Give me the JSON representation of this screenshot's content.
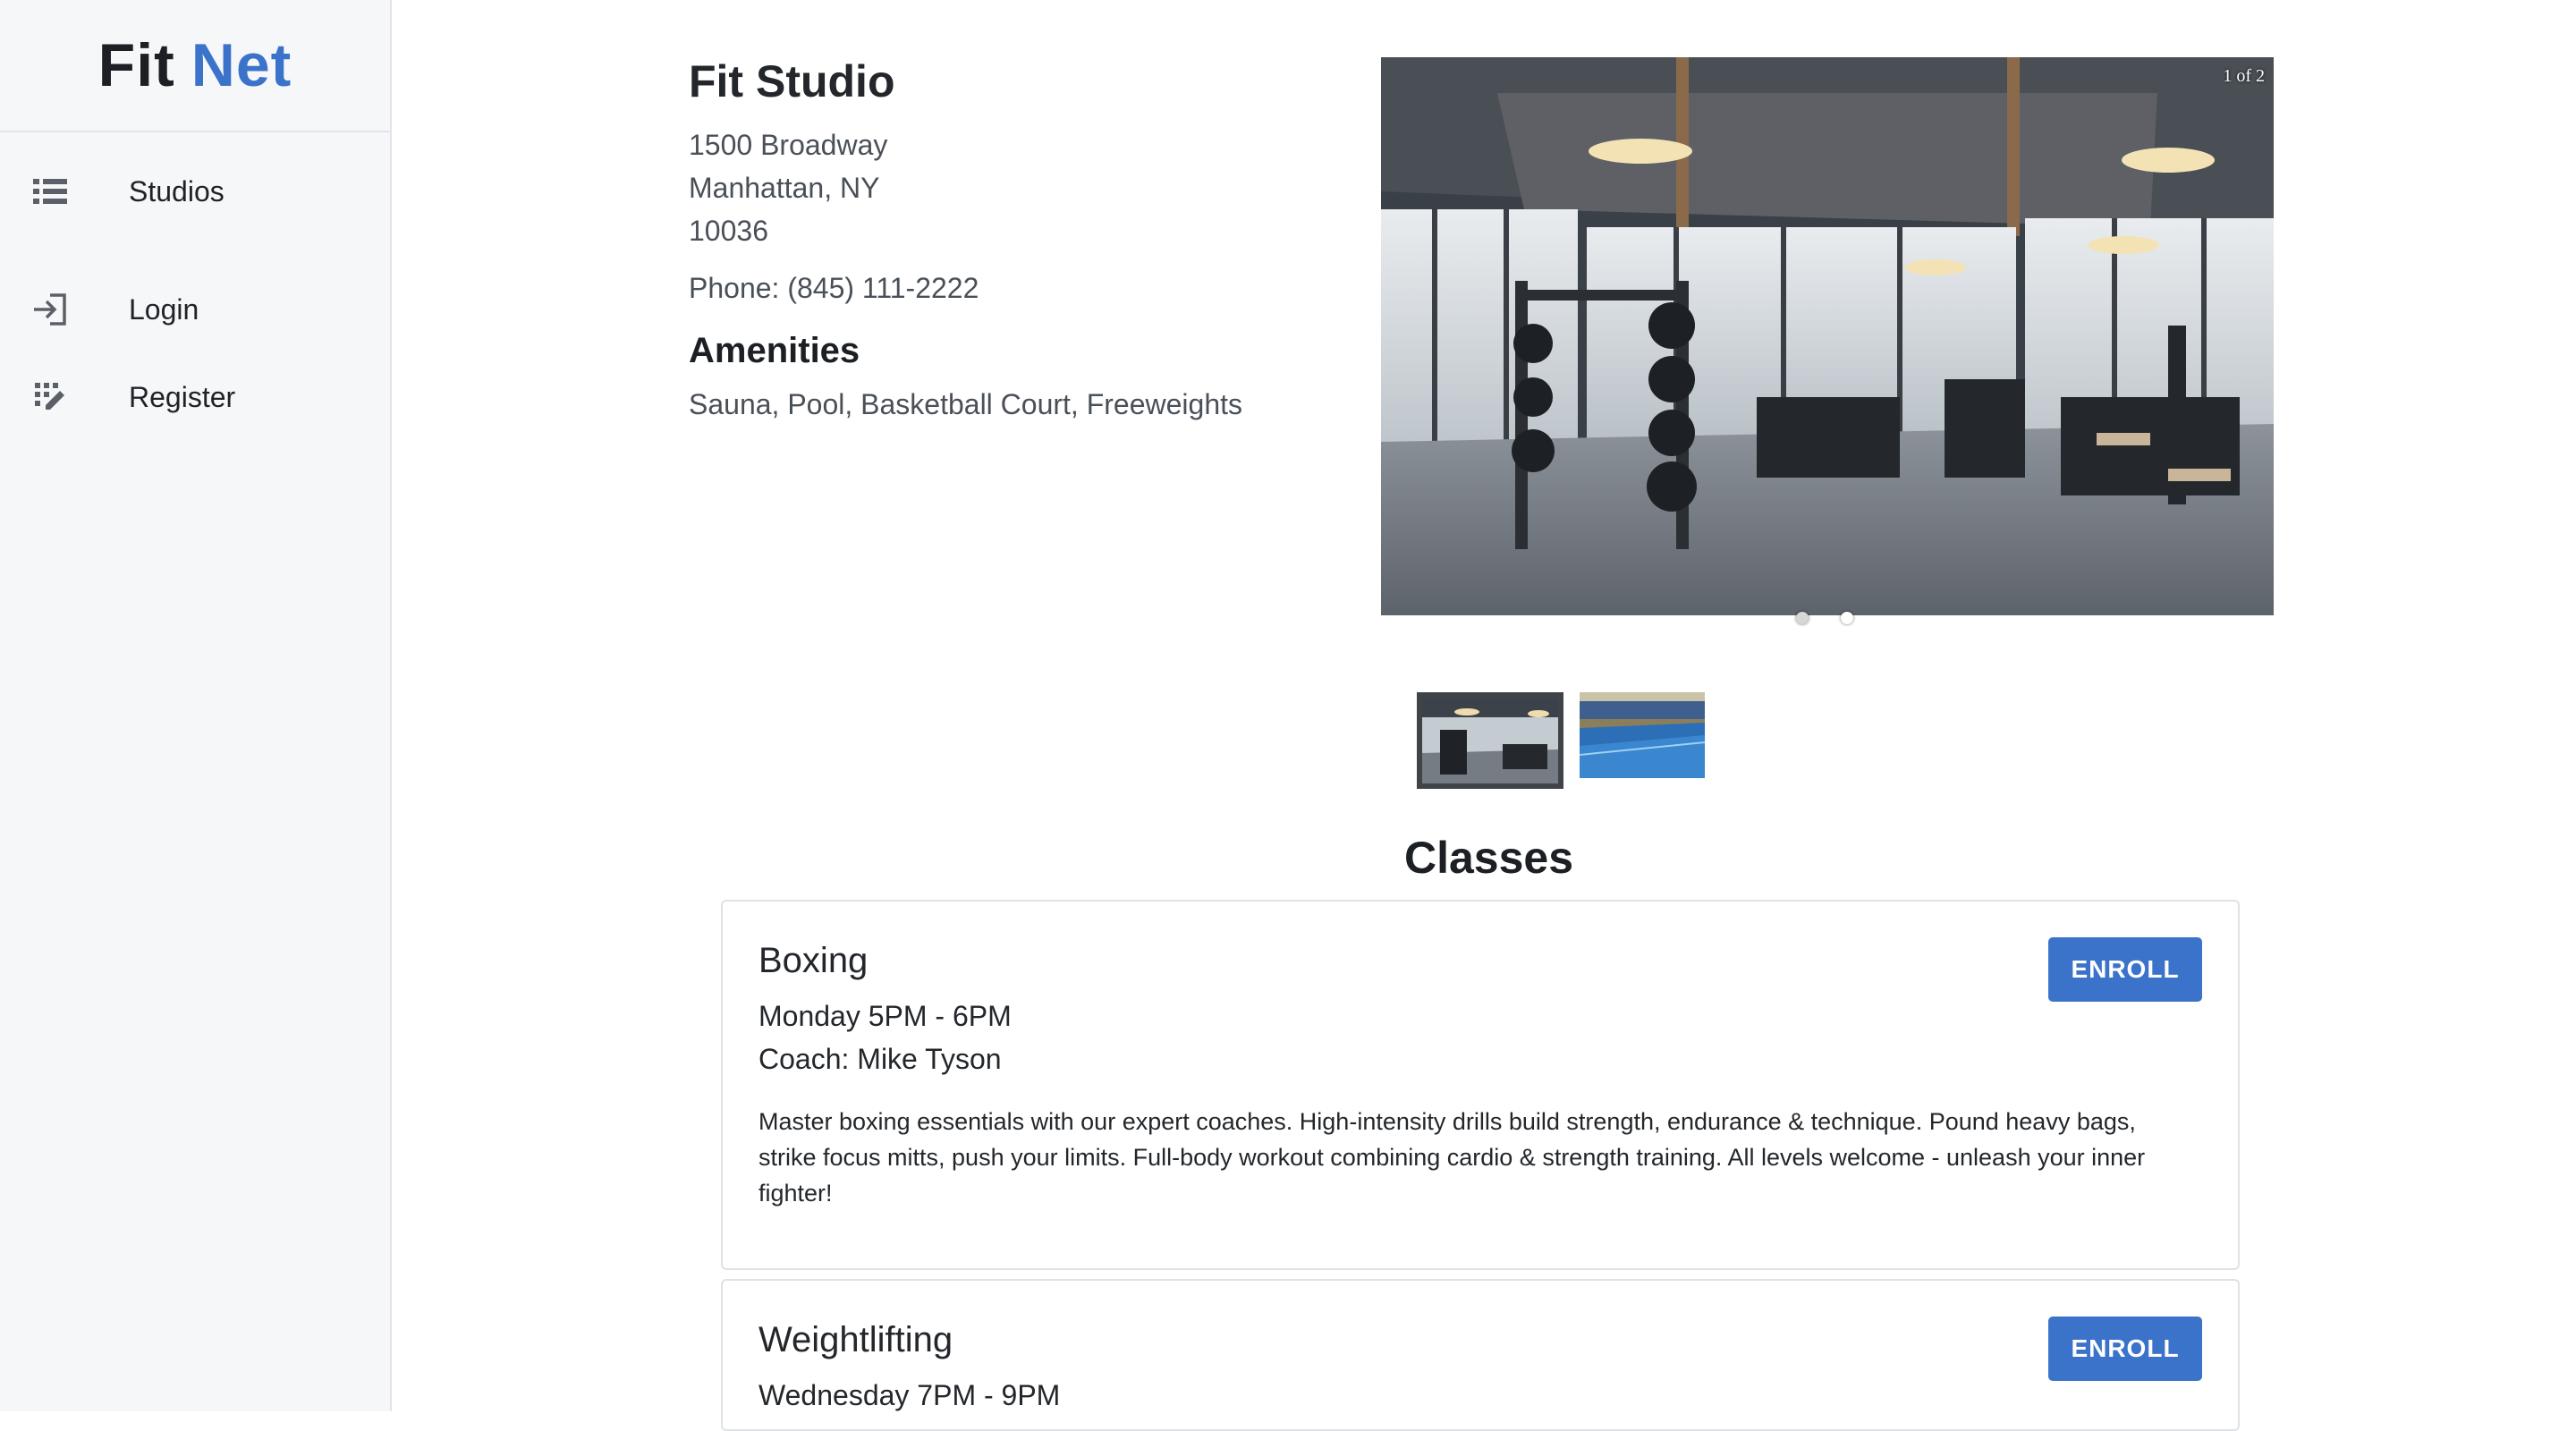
{
  "brand": {
    "part1": "Fit",
    "part2": "Net"
  },
  "sidebar": {
    "items": [
      {
        "label": "Studios",
        "icon": "list-icon"
      },
      {
        "label": "Login",
        "icon": "login-icon"
      },
      {
        "label": "Register",
        "icon": "register-icon"
      }
    ]
  },
  "studio": {
    "name": "Fit Studio",
    "address_line1": "1500 Broadway",
    "address_line2": "Manhattan, NY",
    "zip": "10036",
    "phone": "Phone: (845) 111-2222",
    "amenities_title": "Amenities",
    "amenities": "Sauna, Pool, Basketball Court, Freeweights"
  },
  "carousel": {
    "counter": "1 of 2",
    "current": 1,
    "total": 2,
    "images": [
      "gym-floor-image",
      "pool-image"
    ]
  },
  "classes_title": "Classes",
  "classes": [
    {
      "name": "Boxing",
      "time": "Monday 5PM - 6PM",
      "coach": "Coach: Mike Tyson",
      "description": "Master boxing essentials with our expert coaches. High-intensity drills build strength, endurance & technique. Pound heavy bags, strike focus mitts, push your limits. Full-body workout combining cardio & strength training. All levels welcome - unleash your inner fighter!",
      "button": "ENROLL"
    },
    {
      "name": "Weightlifting",
      "time": "Wednesday 7PM - 9PM",
      "button": "ENROLL"
    }
  ],
  "colors": {
    "accent": "#3a73c9",
    "sidebar_bg": "#f6f7f9",
    "text": "#1f2327"
  }
}
